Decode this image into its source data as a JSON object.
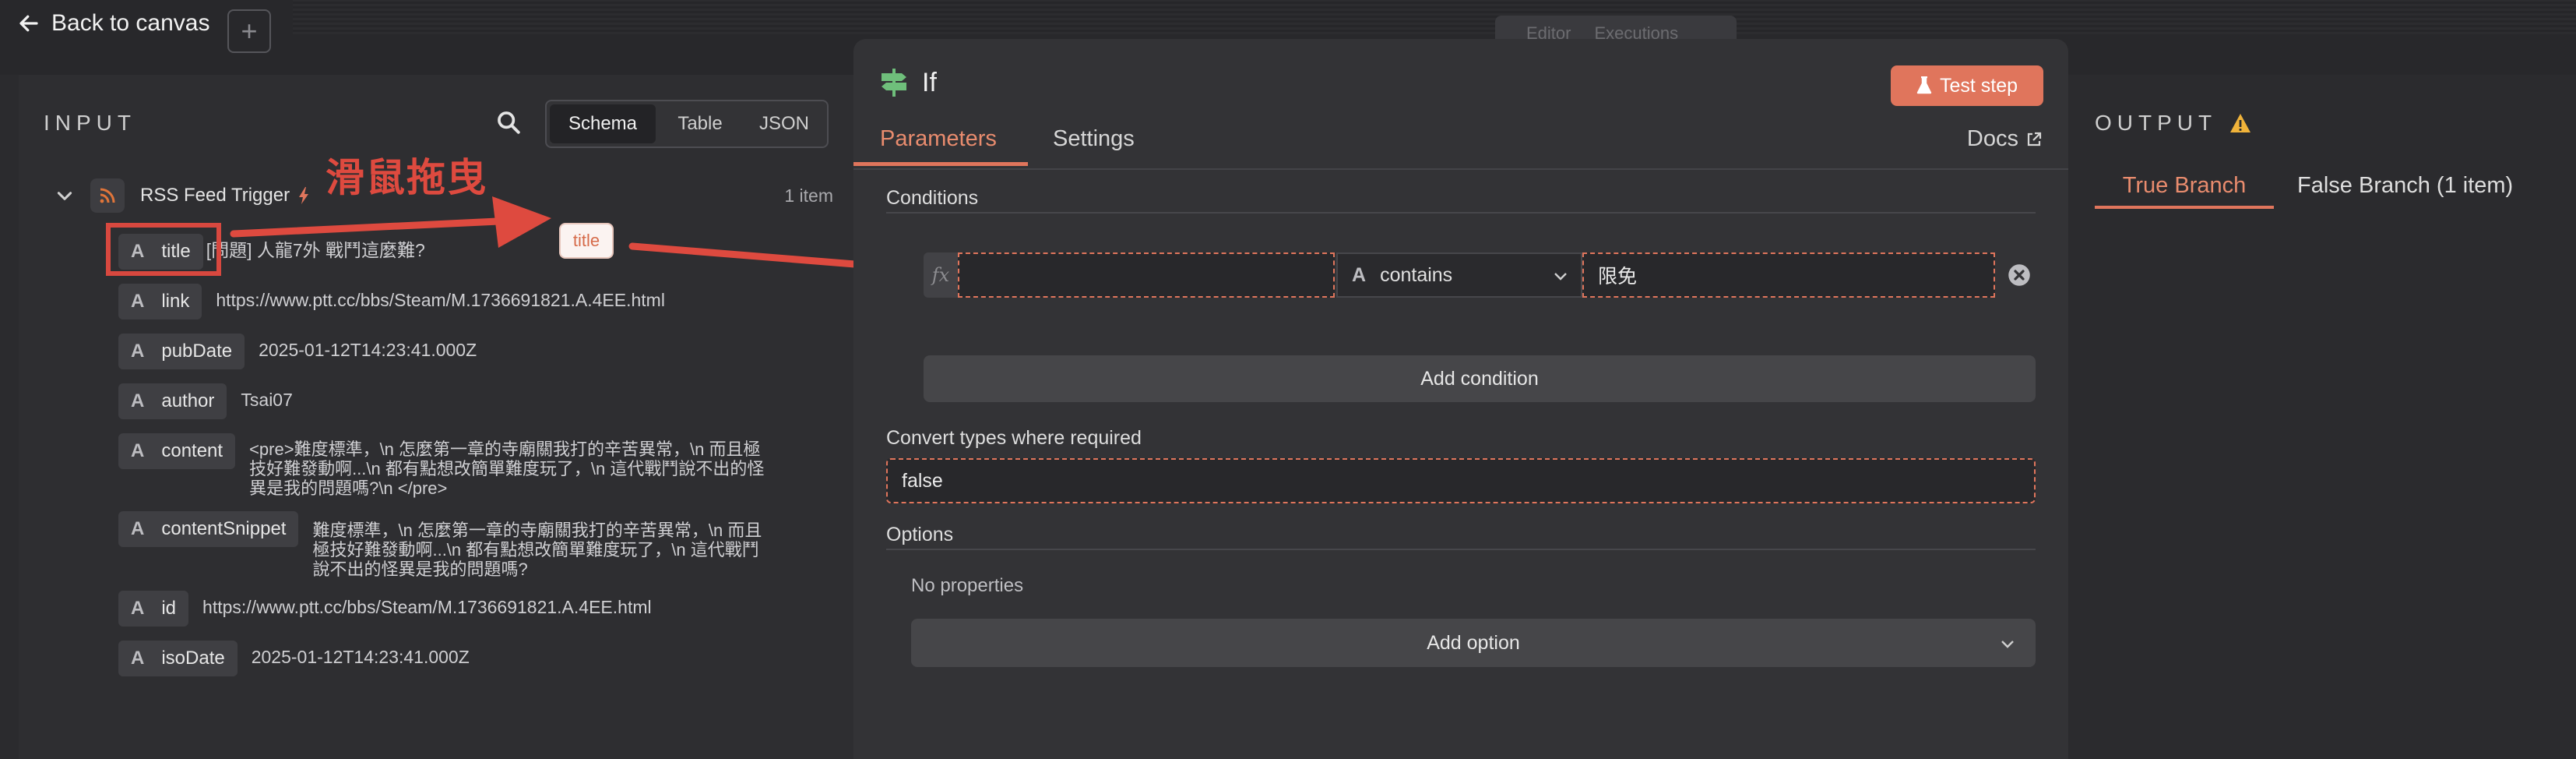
{
  "topbar": {
    "back_label": "Back to canvas",
    "add_label": "+",
    "tabs": [
      "Editor",
      "Executions"
    ]
  },
  "input": {
    "title": "INPUT",
    "view_modes": [
      "Schema",
      "Table",
      "JSON"
    ],
    "active_view": "Schema",
    "node_name": "RSS Feed Trigger",
    "item_count": "1 item",
    "type_glyph": "A",
    "fields": [
      {
        "name": "title",
        "value": "[問題] 人龍7外 戰鬥這麼難?"
      },
      {
        "name": "link",
        "value": "https://www.ptt.cc/bbs/Steam/M.1736691821.A.4EE.html"
      },
      {
        "name": "pubDate",
        "value": "2025-01-12T14:23:41.000Z"
      },
      {
        "name": "author",
        "value": "Tsai07"
      },
      {
        "name": "content",
        "value_lines": [
          "<pre>難度標準，\\n 怎麼第一章的寺廟關我打的辛苦異常，\\n 而且極",
          "技好難發動啊...\\n 都有點想改簡單難度玩了，\\n 這代戰鬥說不出的怪",
          "異是我的問題嗎?\\n </pre>"
        ]
      },
      {
        "name": "contentSnippet",
        "value_lines": [
          "難度標準，\\n 怎麼第一章的寺廟關我打的辛苦異常，\\n 而且",
          "極技好難發動啊...\\n 都有點想改簡單難度玩了，\\n 這代戰鬥",
          "說不出的怪異是我的問題嗎?"
        ]
      },
      {
        "name": "id",
        "value": "https://www.ptt.cc/bbs/Steam/M.1736691821.A.4EE.html"
      },
      {
        "name": "isoDate",
        "value": "2025-01-12T14:23:41.000Z"
      }
    ]
  },
  "annotation": {
    "text": "滑鼠拖曳",
    "drag_pill": "title",
    "color": "#de4a3f"
  },
  "node": {
    "title": "If",
    "test_step": "Test step",
    "tabs": [
      "Parameters",
      "Settings"
    ],
    "active_tab": "Parameters",
    "docs": "Docs",
    "conditions_label": "Conditions",
    "fx": "fx",
    "condition": {
      "left_value": "",
      "operator": "contains",
      "right_value": "限免"
    },
    "add_condition": "Add condition",
    "convert_label": "Convert types where required",
    "convert_value": "false",
    "options_label": "Options",
    "no_properties": "No properties",
    "add_option": "Add option"
  },
  "output": {
    "title": "OUTPUT",
    "branches": [
      "True Branch",
      "False Branch (1 item)"
    ],
    "active_branch": "True Branch"
  },
  "colors": {
    "accent": "#e0755c",
    "annotation": "#de4a3f",
    "background": "#2b2b2e"
  }
}
